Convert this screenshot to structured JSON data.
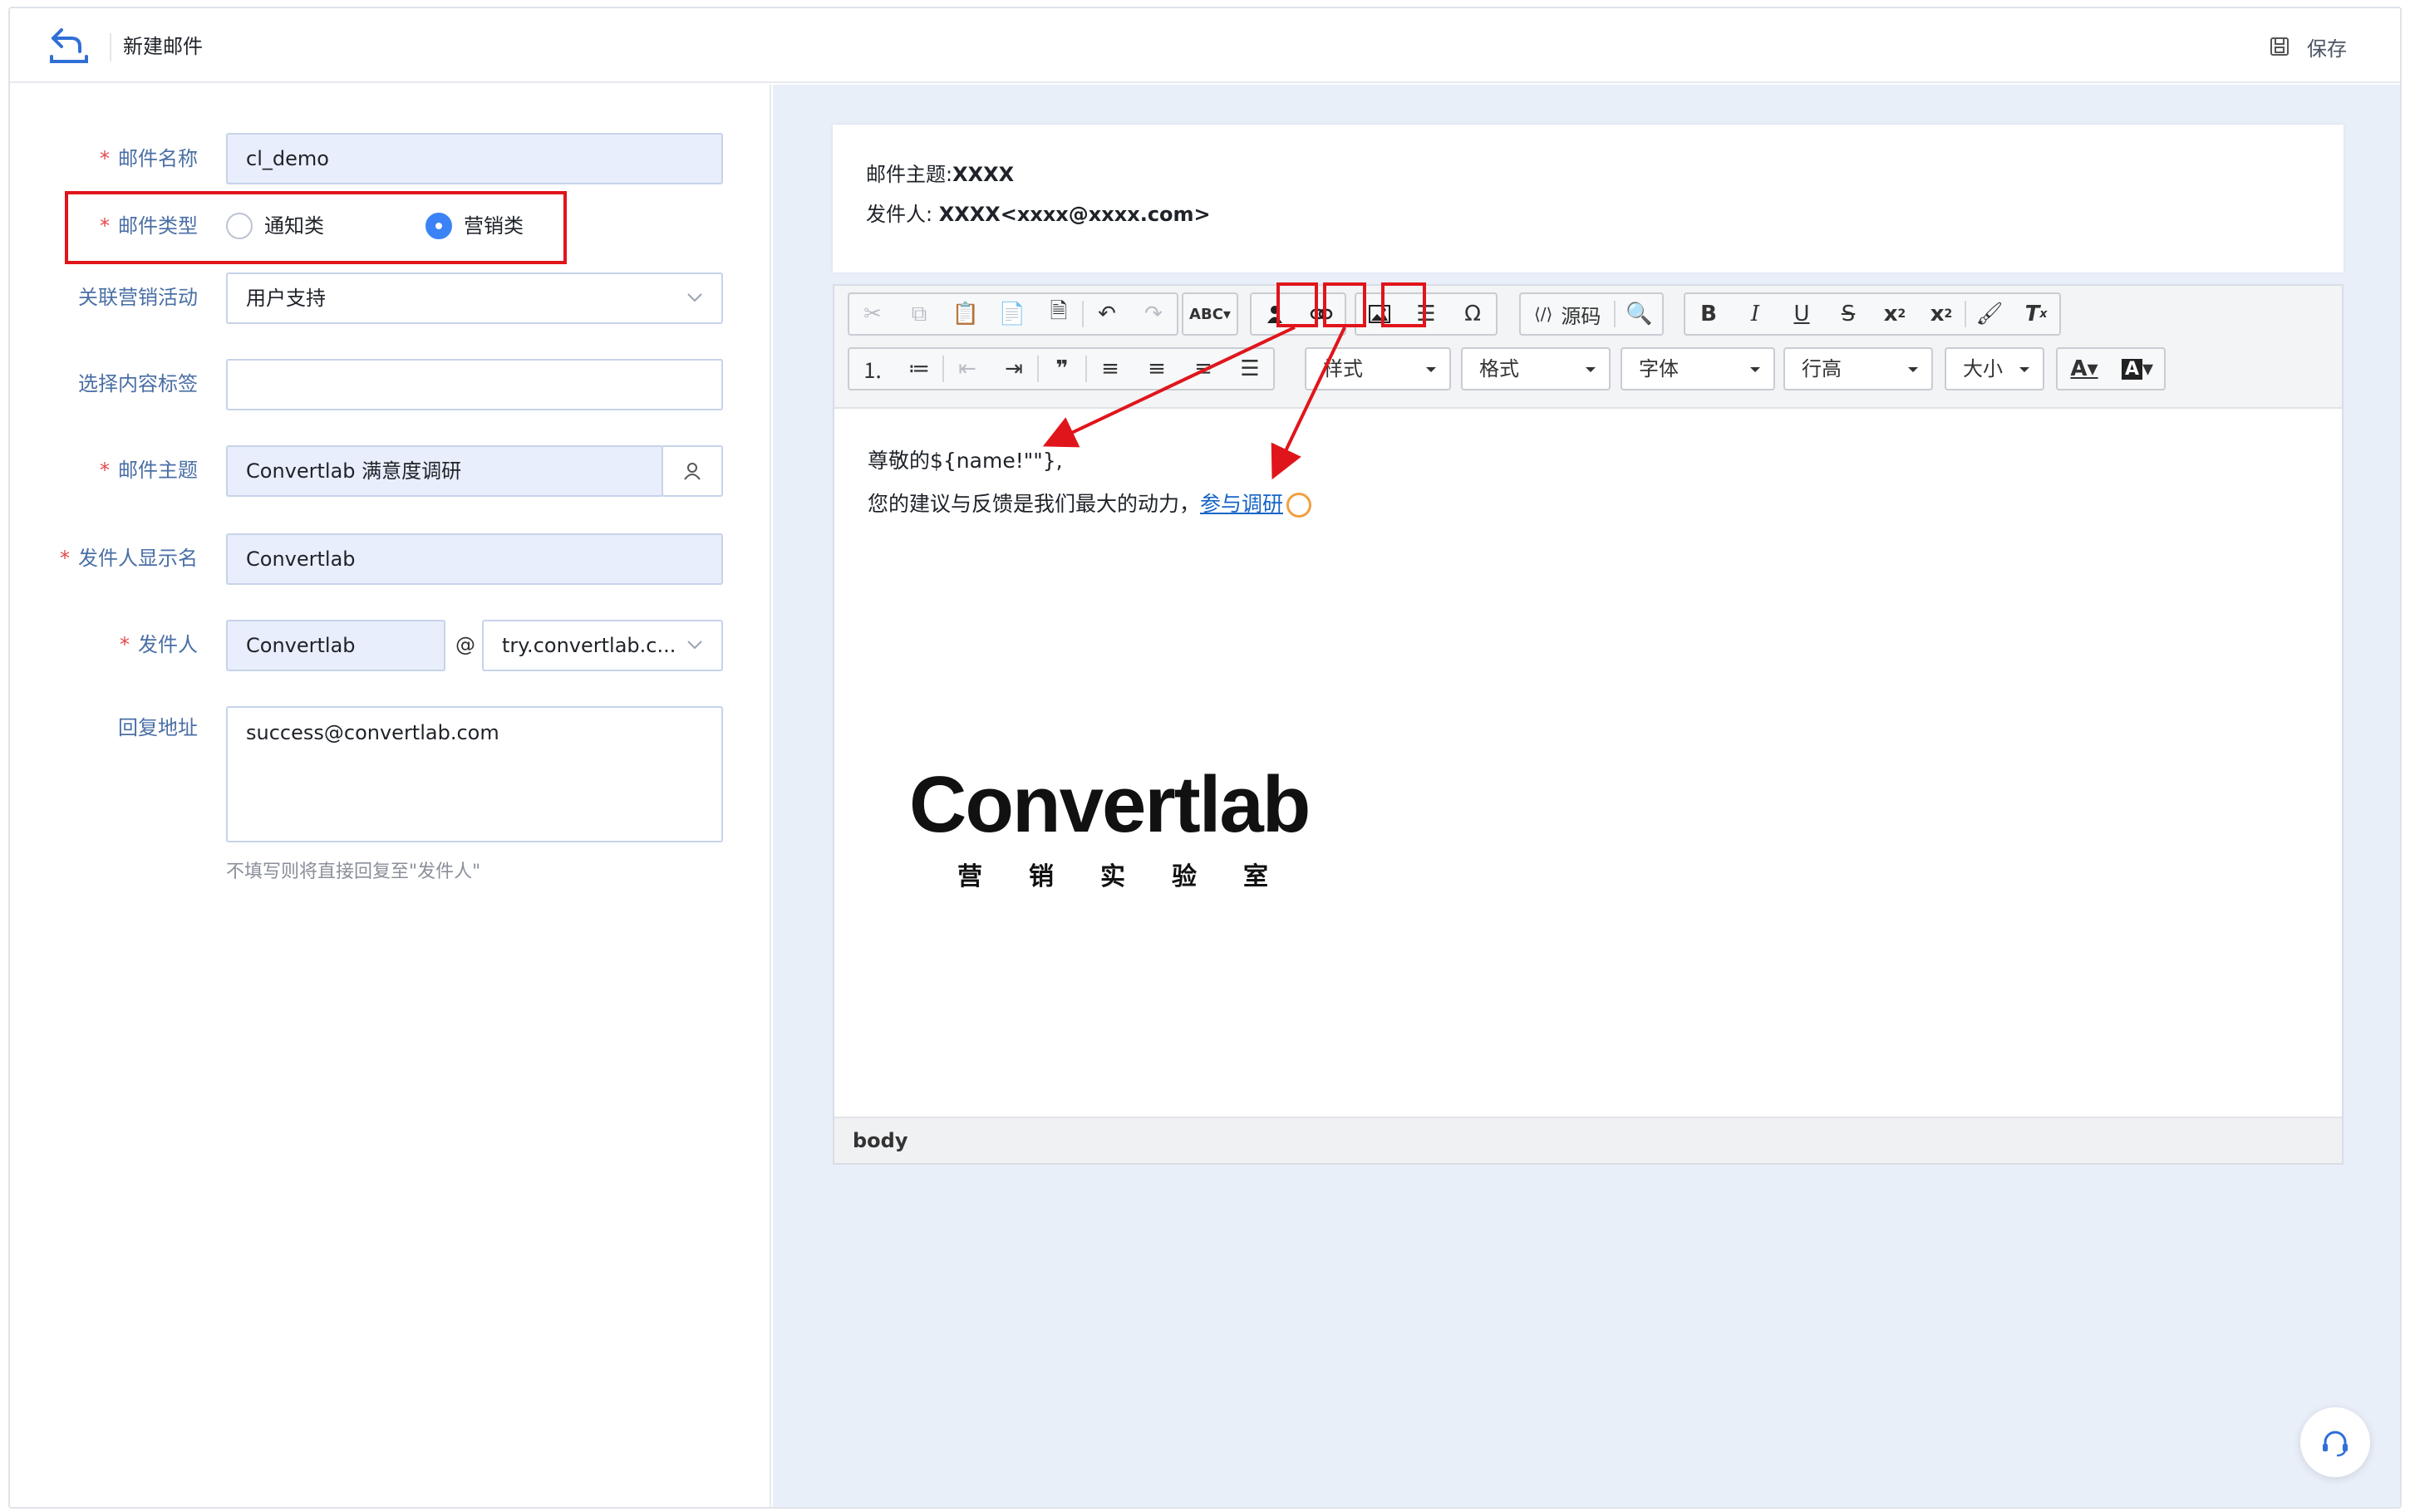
{
  "header": {
    "title": "新建邮件",
    "save_label": "保存"
  },
  "form": {
    "name": {
      "label": "邮件名称",
      "value": "cl_demo"
    },
    "type": {
      "label": "邮件类型",
      "options": [
        "通知类",
        "营销类"
      ],
      "selected": "营销类"
    },
    "campaign": {
      "label": "关联营销活动",
      "value": "用户支持"
    },
    "tags": {
      "label": "选择内容标签",
      "value": ""
    },
    "subject": {
      "label": "邮件主题",
      "value": "Convertlab 满意度调研"
    },
    "sender_display": {
      "label": "发件人显示名",
      "value": "Convertlab"
    },
    "sender": {
      "label": "发件人",
      "local": "Convertlab",
      "at": "@",
      "domain": "try.convertlab.c..."
    },
    "reply": {
      "label": "回复地址",
      "value": "success@convertlab.com",
      "hint": "不填写则将直接回复至\"发件人\""
    }
  },
  "preview": {
    "subject_label": "邮件主题:",
    "subject_value": "XXXX",
    "from_label": "发件人:",
    "from_value": "XXXX<xxxx@xxxx.com>"
  },
  "editor": {
    "toolbar": {
      "source_label": "源码",
      "style_label": "样式",
      "format_label": "格式",
      "font_label": "字体",
      "lineheight_label": "行高",
      "size_label": "大小"
    },
    "content": {
      "greeting": "尊敬的${name!\"\"},",
      "line2_prefix": "您的建议与反馈是我们最大的动力，",
      "link_text": "参与调研"
    },
    "logo": {
      "brand": "Convertlab",
      "sub": "营销实验室"
    },
    "status_path": "body"
  },
  "colors": {
    "accent": "#3b82f6",
    "required": "#e5484d",
    "annotation": "#e0151b",
    "link": "#1764c8"
  }
}
